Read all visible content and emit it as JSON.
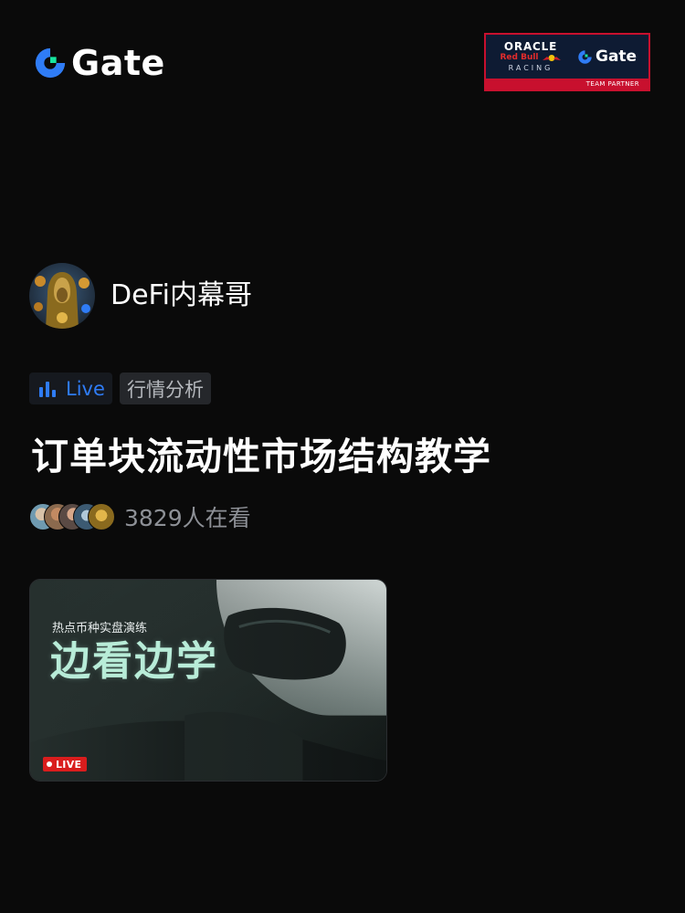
{
  "brand": {
    "name": "Gate",
    "accent": "#17e5a0",
    "blue": "#2f7cf6"
  },
  "partner": {
    "oracle": "ORACLE",
    "redbull": "Red Bull",
    "racing": "RACING",
    "gate": "Gate",
    "team_partner": "TEAM PARTNER"
  },
  "host": {
    "name": "DeFi内幕哥",
    "avatar_icon": "avatar-hooded-figure"
  },
  "tags": {
    "live": "Live",
    "category": "行情分析"
  },
  "stream": {
    "title": "订单块流动性市场结构教学",
    "viewers": "3829人在看"
  },
  "video": {
    "subtitle": "热点币种实盘演练",
    "headline": "边看边学",
    "badge": "LIVE"
  }
}
